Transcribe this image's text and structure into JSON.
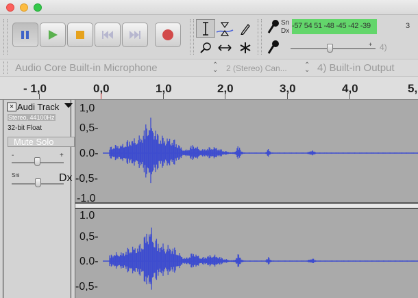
{
  "window": {
    "close": "close",
    "minimize": "minimize",
    "maximize": "maximize"
  },
  "transport": {
    "buttons": [
      "pause",
      "play",
      "stop",
      "skip-start",
      "skip-end",
      "record"
    ]
  },
  "tools": [
    "selection",
    "envelope",
    "draw",
    "zoom",
    "timeshift",
    "multi"
  ],
  "meters": {
    "sn": "Sn",
    "dx": "Dx",
    "ticks": "-57 54 51 -48 -45 -42 -39",
    "overflow": "3",
    "input_level": "4)"
  },
  "devices": {
    "host": "Audio Core Built-in Microphone",
    "channels": "2 (Stereo) Can...",
    "output": "4) Built-in Output"
  },
  "ruler": {
    "labels": [
      "- 1,0",
      "0,0",
      "1,0",
      "2,0",
      "3,0",
      "4,0",
      "5,"
    ]
  },
  "track": {
    "name": "Audi Track",
    "info_rate": "Stereo, 44100Hz",
    "info_format": "32-bit Float",
    "mute_solo": "Mute Solo",
    "gain_minus": "-",
    "gain_plus": "+",
    "pan_label": "Sni",
    "pan_right": "Dx"
  },
  "scale_top": [
    "1,0",
    "0,5-",
    "0.0-",
    "-0,5-",
    "-1,0"
  ],
  "scale_bottom": [
    "1.0",
    "0,5-",
    "0.0-",
    "-0,5-"
  ],
  "colors": {
    "wave": "#3d4ccf",
    "meter": "#63d66b",
    "background": "#aaaaaa"
  }
}
